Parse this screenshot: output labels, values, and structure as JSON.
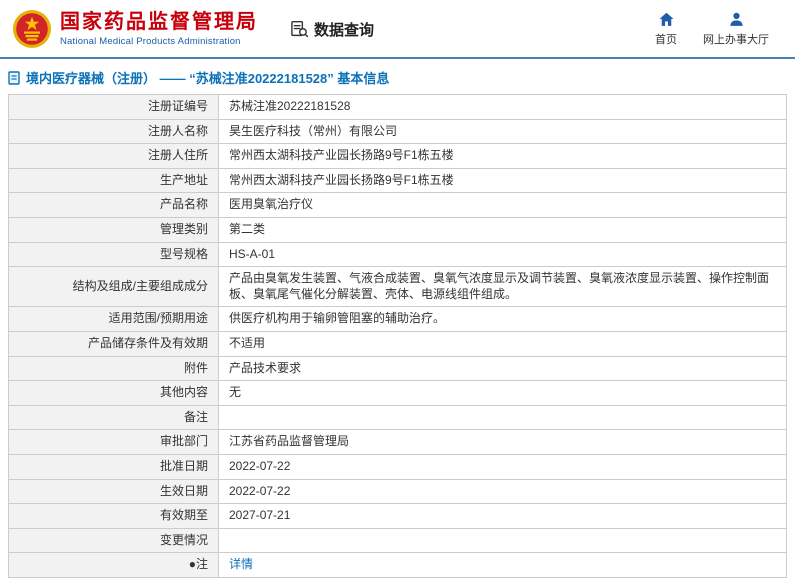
{
  "header": {
    "agency_name_cn": "国家药品监督管理局",
    "agency_name_en": "National Medical Products Administration",
    "data_query_label": "数据查询",
    "home_label": "首页",
    "hall_label": "网上办事大厅"
  },
  "page": {
    "title": "境内医疗器械（注册） —— “苏械注准20222181528” 基本信息"
  },
  "colors": {
    "brand_red": "#c7000b",
    "brand_blue": "#1f5ca9",
    "title_blue": "#0b72b8",
    "table_border": "#cccccc",
    "label_bg": "#f2f2f2",
    "link_blue": "#0b72b8"
  },
  "table": {
    "rows": [
      {
        "label": "注册证编号",
        "value": "苏械注准20222181528"
      },
      {
        "label": "注册人名称",
        "value": "昊生医疗科技（常州）有限公司"
      },
      {
        "label": "注册人住所",
        "value": "常州西太湖科技产业园长扬路9号F1栋五楼"
      },
      {
        "label": "生产地址",
        "value": "常州西太湖科技产业园长扬路9号F1栋五楼"
      },
      {
        "label": "产品名称",
        "value": "医用臭氧治疗仪"
      },
      {
        "label": "管理类别",
        "value": "第二类"
      },
      {
        "label": "型号规格",
        "value": "HS-A-01"
      },
      {
        "label": "结构及组成/主要组成成分",
        "value": "产品由臭氧发生装置、气液合成装置、臭氧气浓度显示及调节装置、臭氧液浓度显示装置、操作控制面板、臭氧尾气催化分解装置、壳体、电源线组件组成。"
      },
      {
        "label": "适用范围/预期用途",
        "value": "供医疗机构用于输卵管阻塞的辅助治疗。"
      },
      {
        "label": "产品储存条件及有效期",
        "value": "不适用"
      },
      {
        "label": "附件",
        "value": "产品技术要求"
      },
      {
        "label": "其他内容",
        "value": "无"
      },
      {
        "label": "备注",
        "value": ""
      },
      {
        "label": "审批部门",
        "value": "江苏省药品监督管理局"
      },
      {
        "label": "批准日期",
        "value": "2022-07-22"
      },
      {
        "label": "生效日期",
        "value": "2022-07-22"
      },
      {
        "label": "有效期至",
        "value": "2027-07-21"
      },
      {
        "label": "变更情况",
        "value": ""
      },
      {
        "label": "●注",
        "value": "详情"
      }
    ]
  }
}
